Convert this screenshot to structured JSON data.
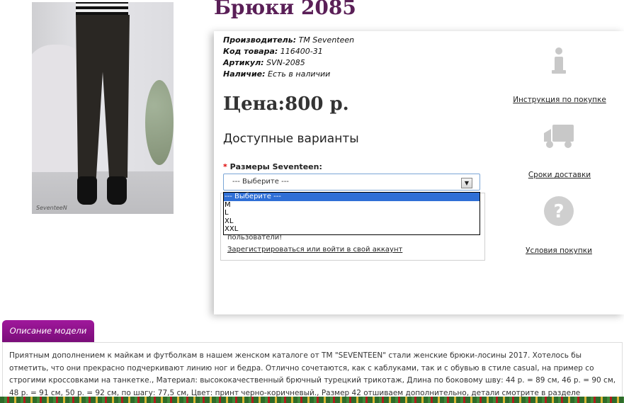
{
  "product": {
    "title": "Брюки 2085",
    "photo_signature": "SeventeeN",
    "manufacturer_label": "Производитель:",
    "manufacturer_value": "TM Seventeen",
    "code_label": "Код товара:",
    "code_value": "116400-31",
    "sku_label": "Артикул:",
    "sku_value": "SVN-2085",
    "availability_label": "Наличие:",
    "availability_value": "Есть в наличии",
    "price": "Цена:800 р."
  },
  "options": {
    "heading": "Доступные варианты",
    "size_required_mark": "*",
    "size_label": "Размеры Seventeen:",
    "size_selected": "--- Выберите ---",
    "size_options": [
      "--- Выберите ---",
      "M",
      "L",
      "XL",
      "XXL"
    ],
    "notice_text": "пользователи!",
    "register_link": "Зарегистрироваться или войти в свой аккаунт"
  },
  "side_links": {
    "instruction": "Инструкция по покупке",
    "delivery": "Сроки доставки",
    "conditions": "Условия покупки",
    "icons": [
      "info-icon",
      "truck-icon",
      "question-icon"
    ]
  },
  "description": {
    "tab_label": "Описание модели",
    "text": "Приятным дополнением к майкам и футболкам в нашем женском каталоге от ТМ \"SEVENTEEN\" стали женские брюки-лосины 2017. Хотелось бы отметить, что они прекрасно подчеркивают линию ног и бедра. Отлично сочетаются, как с каблуками, так и с обувью в стиле casual, на пример со строгими кроссовками на танкетке., Материал: высококачественный брючный турецкий трикотаж, Длина по боковому шву: 44 р. = 89 см, 46 р. = 90 см, 48 р. = 91 см, 50 р. = 92 см, по шагу: 77,5 см, Цвет: принт черно-коричневый., Размер 42 отшиваем дополнительно, детали смотрите в разделе"
  },
  "colors": {
    "title": "#5a1f57",
    "tab": "#8a1487",
    "dropdown_selected": "#2f6fd6"
  }
}
